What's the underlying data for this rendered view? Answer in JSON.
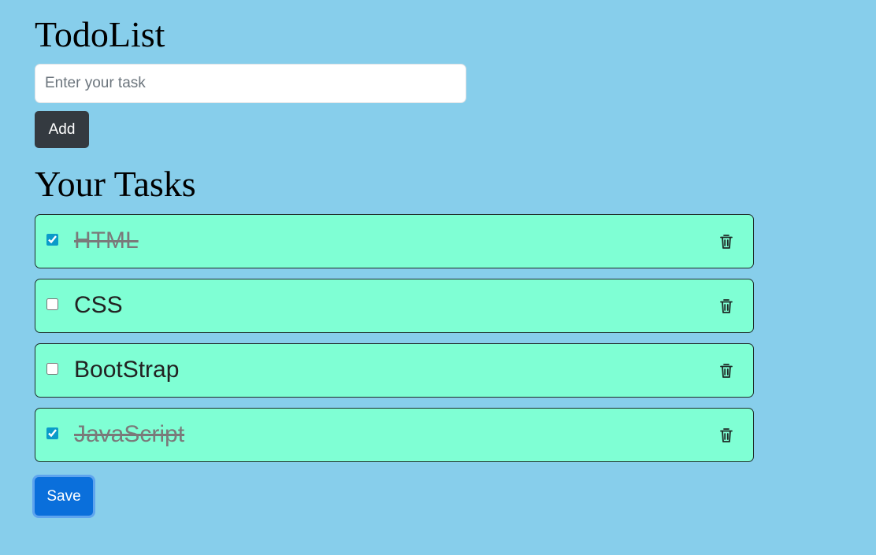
{
  "app": {
    "title": "TodoList"
  },
  "input": {
    "placeholder": "Enter your task",
    "value": ""
  },
  "buttons": {
    "add_label": "Add",
    "save_label": "Save"
  },
  "section": {
    "title": "Your Tasks"
  },
  "tasks": [
    {
      "text": "HTML",
      "completed": true
    },
    {
      "text": "CSS",
      "completed": false
    },
    {
      "text": "BootStrap",
      "completed": false
    },
    {
      "text": "JavaScript",
      "completed": true
    }
  ],
  "icons": {
    "delete": "trash-icon"
  },
  "colors": {
    "background": "#87ceeb",
    "task_background": "#7fffd4",
    "add_button": "#343a40",
    "save_button": "#0a6fdb"
  }
}
